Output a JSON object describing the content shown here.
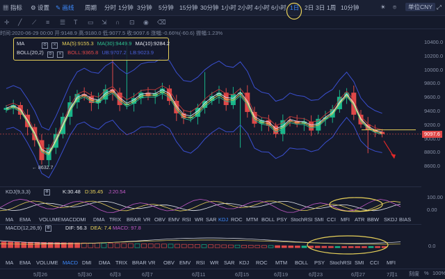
{
  "topbar": {
    "logo_label": "指标",
    "settings_label": "设置",
    "draw_label": "画线",
    "chart_type_label": "周期",
    "periods": [
      "分时",
      "1分钟",
      "3分钟",
      "5分钟",
      "15分钟",
      "30分钟",
      "1小时",
      "2小时",
      "4小时",
      "6小时",
      "1日",
      "2日",
      "3日",
      "1周",
      "10分钟"
    ],
    "active_period": "1日",
    "currency_label": "单位CNY",
    "icons": [
      "sun-icon",
      "camera-icon",
      "fullscreen-icon",
      "close-icon"
    ]
  },
  "info": {
    "text": "时间:2020-06-29 00:00  开:9148.9  高:9180.0  低:9077.5  收:9097.6  涨幅:-0.66%(-60.6)  振幅:1.23%"
  },
  "legend": {
    "ma_name": "MA",
    "ma5": "MA(5):9155.3",
    "ma30": "MA(30):9449.9",
    "ma10": "MA(10):9284.2",
    "boll_name": "BOLL(20,2)",
    "boll_up": "BOLL:9365.8",
    "boll_mid": "UB:9707.2",
    "boll_low": "LB:9023.9"
  },
  "price_axis": [
    "10400.0",
    "10200.0",
    "10000.0",
    "9800.0",
    "9600.0",
    "9400.0",
    "9200.0",
    "9000.0",
    "8800.0",
    "8600.0"
  ],
  "current_price": "9097.6",
  "low_marker": "8632.7",
  "kdj": {
    "name": "KDJ(9,3,3)",
    "k": "K:30.48",
    "d": "D:35.45",
    "j": "J:20.54",
    "axis": [
      "100.00",
      "0.00"
    ]
  },
  "macd": {
    "name": "MACD(12,26,9)",
    "dif": "DIF: 56.3",
    "dea": "DEA: 7.4",
    "macd": "MACD: 97.8",
    "axis": [
      "0.0"
    ]
  },
  "indicator_tabs_1": [
    "MA",
    "EMA",
    "VOLUME",
    "MACD",
    "DMI",
    "DMA",
    "TRIX",
    "BRAR",
    "VR",
    "OBV",
    "EMV",
    "RSI",
    "WR",
    "SAR",
    "KDJ",
    "ROC",
    "MTM",
    "BOLL",
    "PSY",
    "StochRSI",
    "SMI",
    "CCI",
    "MFI",
    "ATR",
    "BBW",
    "SKDJ",
    "BIAS"
  ],
  "indicator_tabs_1_active": "KDJ",
  "indicator_tabs_2": [
    "MA",
    "EMA",
    "VOLUME",
    "MACD",
    "DMI",
    "DMA",
    "TRIX",
    "BRAR",
    "VR",
    "OBV",
    "EMV",
    "RSI",
    "WR",
    "SAR",
    "KDJ",
    "ROC",
    "MTM",
    "BOLL",
    "PSY",
    "StochRSI",
    "SMI",
    "CCI",
    "MFI"
  ],
  "indicator_tabs_2_active": "MACD",
  "dates": [
    "5月26",
    "5月30",
    "6月3",
    "6月7",
    "6月11",
    "6月15",
    "6月19",
    "6月23",
    "6月27",
    "7月1"
  ],
  "bottom_right": [
    "刻度",
    "%",
    "100%"
  ],
  "colors": {
    "up": "#19b58a",
    "down": "#e04848",
    "accent": "#3d8bff",
    "highlight": "#e8d15a",
    "arrow": "#e02828"
  }
}
